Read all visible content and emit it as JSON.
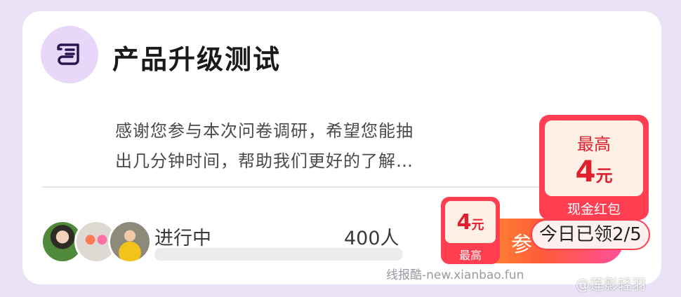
{
  "survey": {
    "title": "产品升级测试",
    "description_line1": "感谢您参与本次问卷调研，希望您能抽",
    "description_line2": "出几分钟时间，帮助我们更好的了解…",
    "status": "进行中",
    "participants": "400人",
    "progress_fraction": 0,
    "header_icon": "scroll-icon"
  },
  "rewards": {
    "small_coupon": {
      "amount": "4",
      "unit": "元",
      "caption": "最高"
    },
    "big_coupon": {
      "top_label": "最高",
      "amount": "4",
      "unit": "元",
      "caption": "现金红包"
    },
    "claimed": "今日已领2/5"
  },
  "join_button": {
    "label": "参"
  },
  "watermarks": {
    "site": "线报酷-new.xianbao.fun",
    "user": "@莲影轻羽"
  },
  "colors": {
    "accent_purple": "#6a2fc4",
    "reward_red": "#ff3e52",
    "button_gradient_start": "#ff9a2e",
    "button_gradient_end": "#ff4f9c"
  }
}
